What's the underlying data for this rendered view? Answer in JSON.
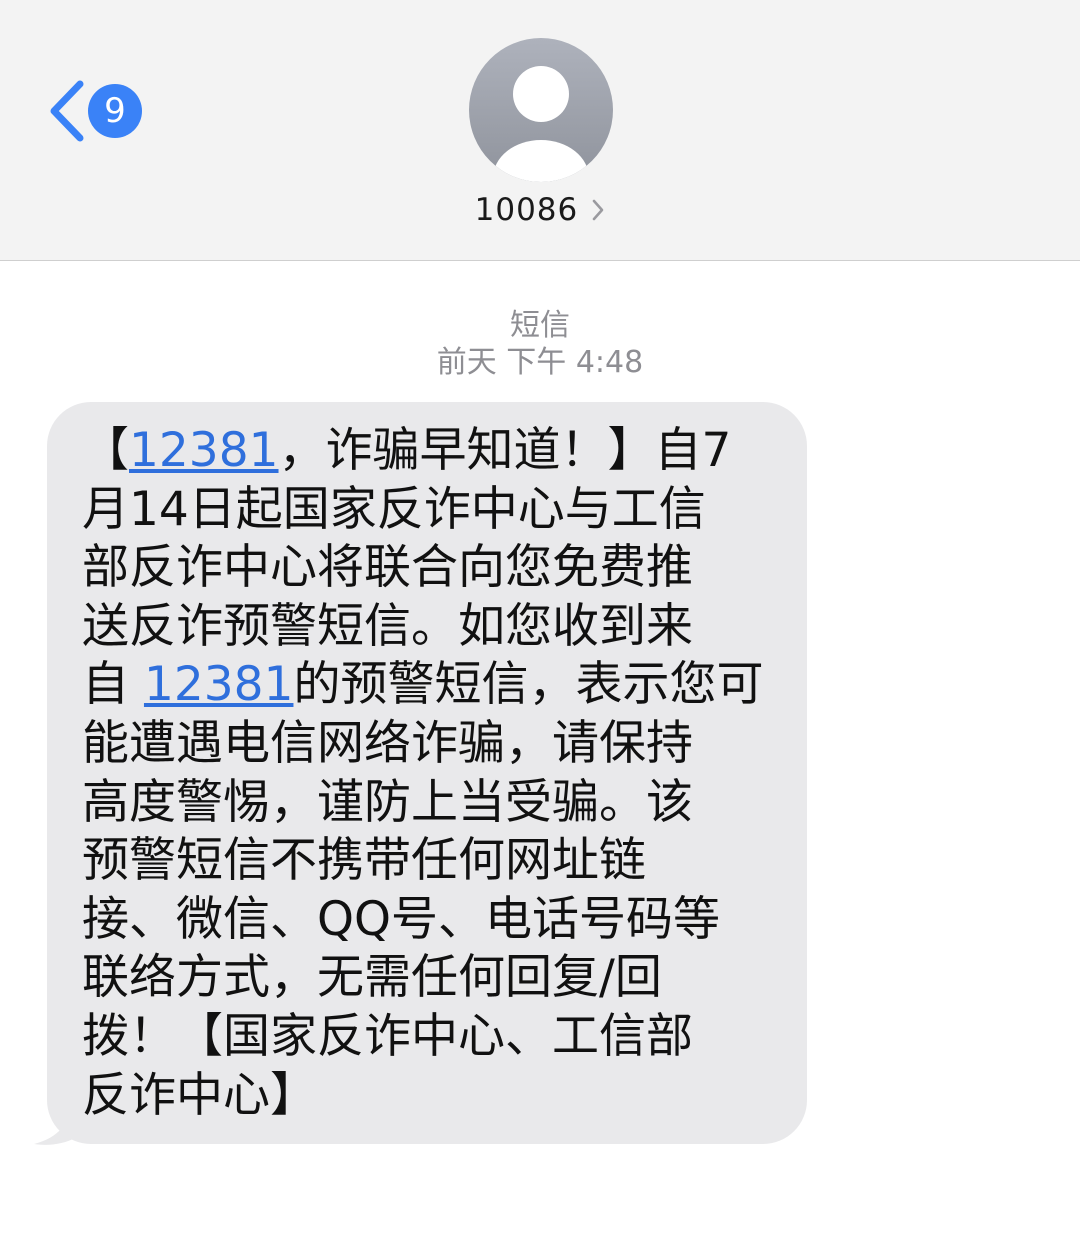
{
  "header": {
    "unread_count": "9",
    "contact_name": "10086"
  },
  "meta": {
    "service_label": "短信",
    "timestamp": "前天 下午 4:48"
  },
  "message": {
    "line1": {
      "pre": "【",
      "link": "12381",
      "post": "，诈骗早知道！】自7"
    },
    "line2": "月14日起国家反诈中心与工信",
    "line3": "部反诈中心将联合向您免费推",
    "line4": "送反诈预警短信。如您收到来",
    "line5": {
      "pre": "自 ",
      "link": "12381",
      "post": "的预警短信，表示您可"
    },
    "line6": "能遭遇电信网络诈骗，请保持",
    "line7": "高度警惕，谨防上当受骗。该",
    "line8": "预警短信不携带任何网址链",
    "line9": "接、微信、QQ号、电话号码等",
    "line10": "联络方式，无需任何回复/回",
    "line11": "拨！【国家反诈中心、工信部",
    "line12": "反诈中心】"
  },
  "colors": {
    "header_bg": "#f3f3f3",
    "accent_blue": "#3a82f7",
    "link_blue": "#2f6fdc",
    "bubble_bg": "#e9e9eb",
    "meta_gray": "#8e8e93"
  },
  "icons": {
    "back": "chevron-left-icon",
    "avatar": "person-silhouette-icon",
    "contact_detail": "chevron-right-icon"
  }
}
